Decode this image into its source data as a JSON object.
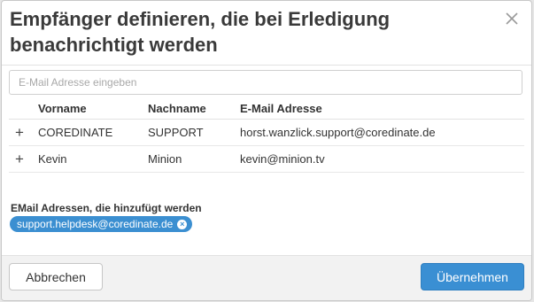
{
  "dialog": {
    "title": "Empfänger definieren, die bei Erledigung benachrichtigt werden"
  },
  "search": {
    "placeholder": "E-Mail Adresse eingeben",
    "value": ""
  },
  "table": {
    "headers": {
      "firstname": "Vorname",
      "lastname": "Nachname",
      "email": "E-Mail Adresse"
    },
    "rows": [
      {
        "add": "+",
        "firstname": "COREDINATE",
        "lastname": "SUPPORT",
        "email": "horst.wanzlick.support@coredinate.de"
      },
      {
        "add": "+",
        "firstname": "Kevin",
        "lastname": "Minion",
        "email": "kevin@minion.tv"
      }
    ]
  },
  "added": {
    "label": "EMail Adressen, die hinzufügt werden",
    "chips": [
      {
        "email": "support.helpdesk@coredinate.de",
        "remove_icon": "×"
      }
    ]
  },
  "footer": {
    "cancel_label": "Abbrechen",
    "ok_label": "Übernehmen"
  },
  "colors": {
    "accent": "#3a8fd3",
    "chip": "#3b8fd1"
  },
  "icons": {
    "close": "close-icon",
    "add": "plus-icon",
    "remove": "remove-circle-icon"
  }
}
